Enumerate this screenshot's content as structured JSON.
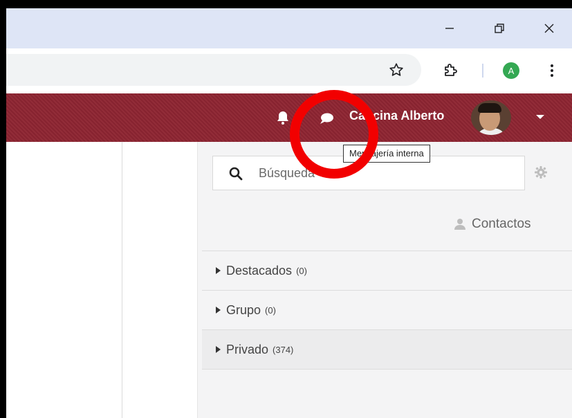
{
  "browser": {
    "profile_initial": "A",
    "colors": {
      "titlebar": "#dee5f6",
      "profile": "#34a853"
    }
  },
  "navbar": {
    "user_name": "Cancina Alberto",
    "tooltip": "Mensajería interna",
    "color": "#8e2532"
  },
  "panel": {
    "search_placeholder": "Búsqueda",
    "contacts_label": "Contactos",
    "sections": [
      {
        "label": "Destacados",
        "count": "(0)"
      },
      {
        "label": "Grupo",
        "count": "(0)"
      },
      {
        "label": "Privado",
        "count": "(374)"
      }
    ]
  },
  "annotation": {
    "color": "#f20000"
  }
}
